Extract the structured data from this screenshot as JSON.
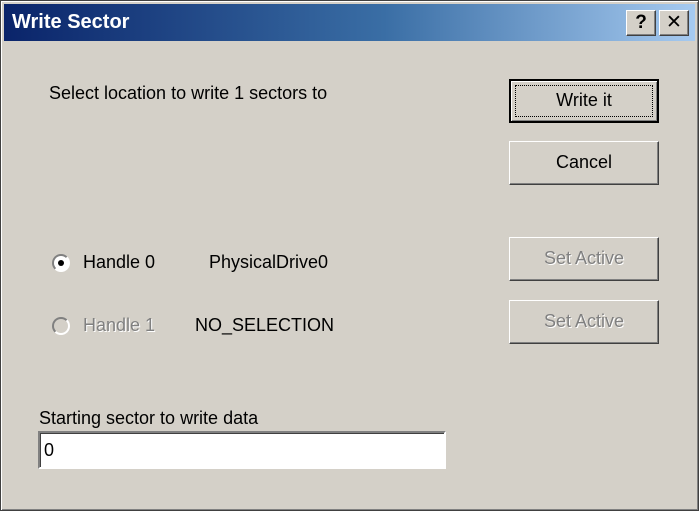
{
  "window": {
    "title": "Write Sector",
    "help_label": "?",
    "close_label": "✕"
  },
  "prompt": "Select location to write 1 sectors to",
  "buttons": {
    "write_it": "Write it",
    "cancel": "Cancel",
    "set_active_0": "Set Active",
    "set_active_1": "Set Active"
  },
  "handles": [
    {
      "label": "Handle 0",
      "drive": "PhysicalDrive0",
      "selected": true,
      "enabled": true
    },
    {
      "label": "Handle 1",
      "drive": "NO_SELECTION",
      "selected": false,
      "enabled": false
    }
  ],
  "starting_sector": {
    "label": "Starting sector to write data",
    "value": "0"
  }
}
